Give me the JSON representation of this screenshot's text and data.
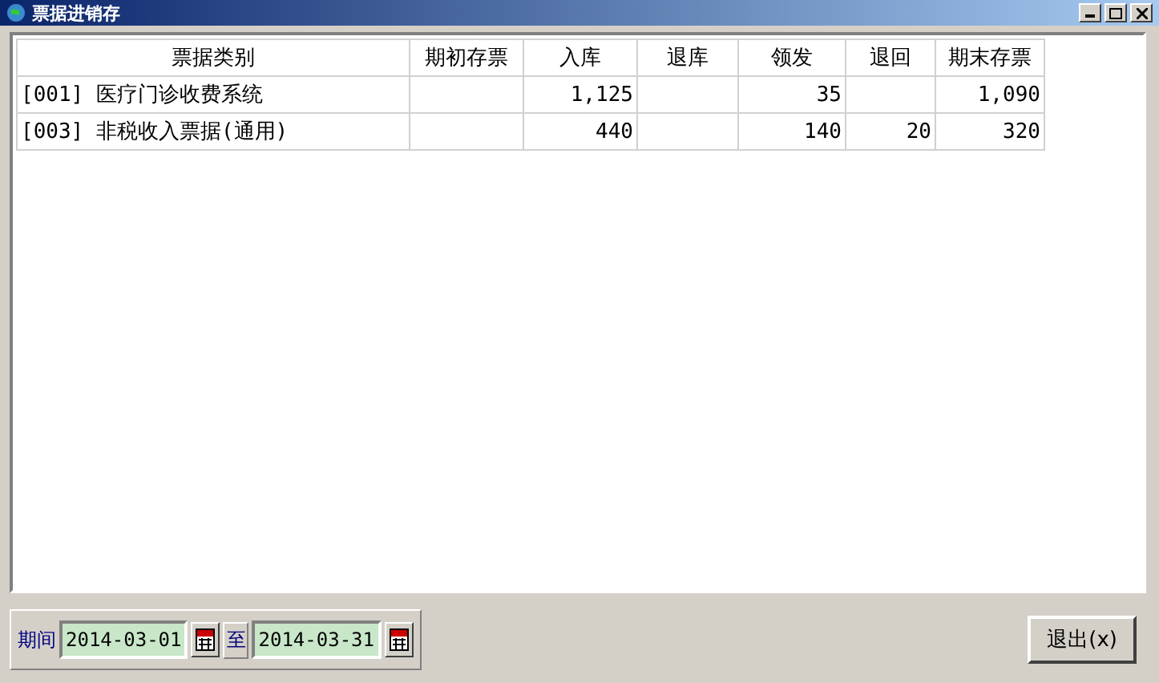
{
  "window": {
    "title": "票据进销存"
  },
  "table": {
    "columns": [
      "票据类别",
      "期初存票",
      "入库",
      "退库",
      "领发",
      "退回",
      "期末存票"
    ],
    "rows": [
      {
        "cells": [
          "[001] 医疗门诊收费系统",
          "",
          "1,125",
          "",
          "35",
          "",
          "1,090"
        ]
      },
      {
        "cells": [
          "[003] 非税收入票据(通用)",
          "",
          "440",
          "",
          "140",
          "20",
          "320"
        ]
      }
    ]
  },
  "period": {
    "label": "期间",
    "from": "2014-03-01",
    "separator": "至",
    "to": "2014-03-31"
  },
  "buttons": [
    {
      "label": "退出(x)"
    }
  ]
}
